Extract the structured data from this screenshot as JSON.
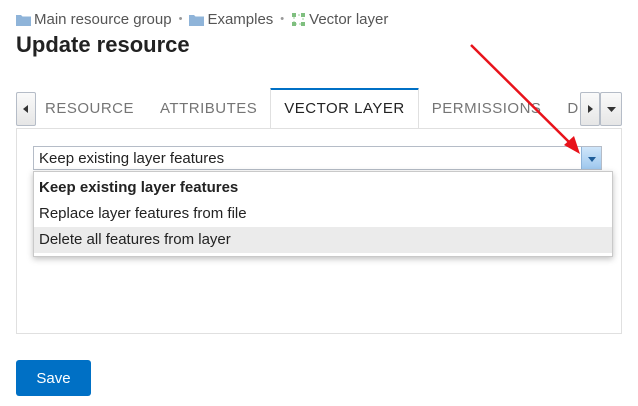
{
  "breadcrumb": {
    "items": [
      {
        "label": "Main resource group",
        "icon": "folder-icon"
      },
      {
        "label": "Examples",
        "icon": "folder-icon"
      },
      {
        "label": "Vector layer",
        "icon": "vector-layer-icon"
      }
    ],
    "separator": "•"
  },
  "page": {
    "title": "Update resource"
  },
  "tabs": {
    "items": [
      {
        "label": "Resource",
        "active": false
      },
      {
        "label": "Attributes",
        "active": false
      },
      {
        "label": "Vector layer",
        "active": true
      },
      {
        "label": "Permissions",
        "active": false
      },
      {
        "label": "Description",
        "active": false
      }
    ]
  },
  "vector_layer": {
    "select": {
      "value": "Keep existing layer features",
      "options": [
        {
          "label": "Keep existing layer features",
          "selected": true,
          "hovered": false
        },
        {
          "label": "Replace layer features from file",
          "selected": false,
          "hovered": false
        },
        {
          "label": "Delete all features from layer",
          "selected": false,
          "hovered": true
        }
      ]
    }
  },
  "actions": {
    "save_label": "Save"
  },
  "colors": {
    "accent": "#0070c5",
    "folder_icon": "#8fb4d9",
    "annotation_arrow": "#e8131b",
    "hover_row": "#ebebeb"
  }
}
